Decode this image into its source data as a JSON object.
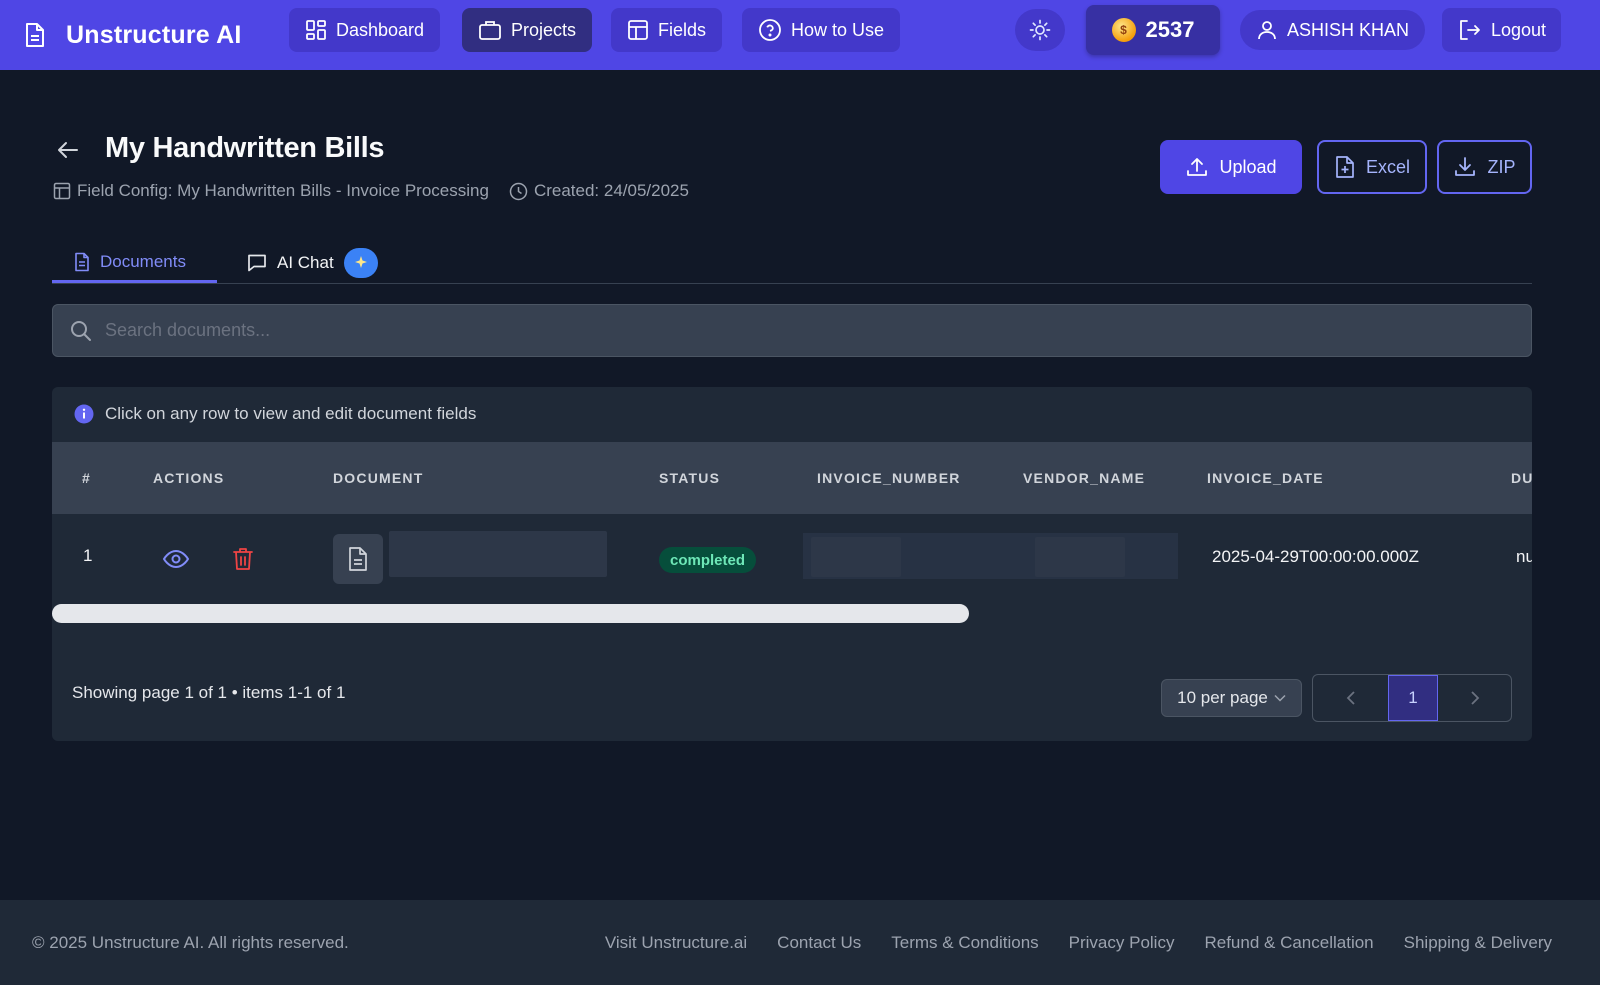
{
  "nav": {
    "brand": "Unstructure AI",
    "items": [
      {
        "label": "Dashboard",
        "icon": "dashboard-icon",
        "active": false
      },
      {
        "label": "Projects",
        "icon": "briefcase-icon",
        "active": true
      },
      {
        "label": "Fields",
        "icon": "table-icon",
        "active": false
      },
      {
        "label": "How to Use",
        "icon": "help-icon",
        "active": false
      }
    ],
    "theme_icon": "sun-icon",
    "credits": "2537",
    "coin_symbol": "$",
    "user": "ASHISH KHAN",
    "logout": "Logout"
  },
  "header": {
    "title": "My Handwritten Bills",
    "field_config": "Field Config: My Handwritten Bills - Invoice Processing",
    "created": "Created: 24/05/2025",
    "upload": "Upload",
    "excel": "Excel",
    "zip": "ZIP"
  },
  "tabs": [
    {
      "label": "Documents",
      "active": true
    },
    {
      "label": "AI Chat",
      "active": false
    }
  ],
  "search": {
    "placeholder": "Search documents..."
  },
  "table": {
    "info": "Click on any row to view and edit document fields",
    "columns": [
      "#",
      "ACTIONS",
      "DOCUMENT",
      "STATUS",
      "INVOICE_NUMBER",
      "VENDOR_NAME",
      "INVOICE_DATE",
      "DU"
    ],
    "rows": [
      {
        "index": "1",
        "status": "completed",
        "invoice_date": "2025-04-29T00:00:00.000Z",
        "next_col": "nu"
      }
    ],
    "pagination": {
      "summary": "Showing page 1 of 1 • items 1-1 of 1",
      "per_page": "10 per page",
      "current_page": "1"
    }
  },
  "footer": {
    "copyright": "© 2025 Unstructure AI. All rights reserved.",
    "links": [
      "Visit Unstructure.ai",
      "Contact Us",
      "Terms & Conditions",
      "Privacy Policy",
      "Refund & Cancellation",
      "Shipping & Delivery"
    ]
  },
  "colors": {
    "navbar": "#4f46e5",
    "background": "#111827",
    "accent": "#6366f1",
    "status_completed": "#6ee7b7",
    "delete": "#ef4444"
  }
}
